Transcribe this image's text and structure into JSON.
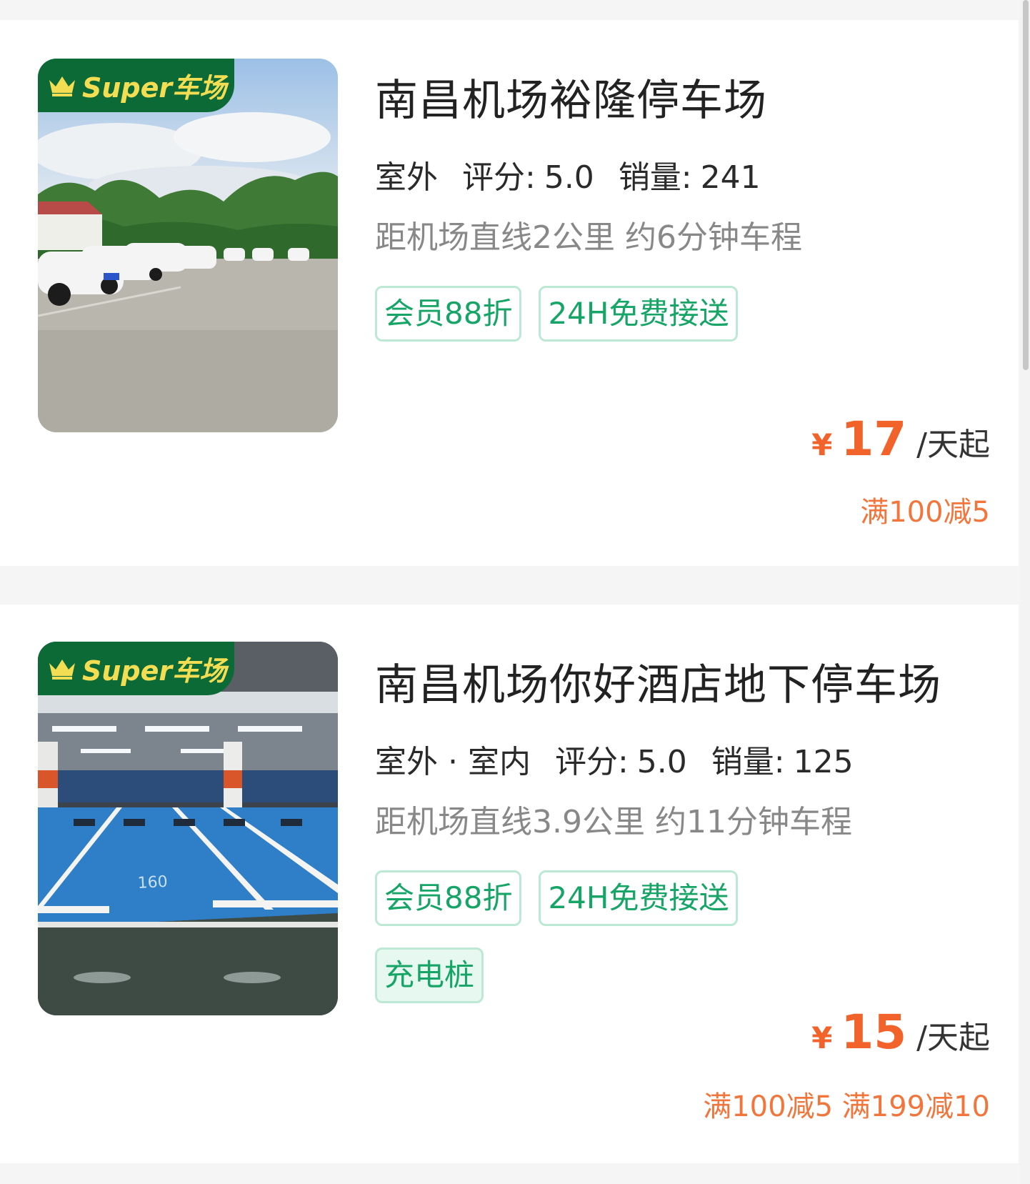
{
  "listings": [
    {
      "badge_text": "Super车场",
      "name": "南昌机场裕隆停车场",
      "types": "室外",
      "rating_label": "评分:",
      "rating": "5.0",
      "sales_label": "销量:",
      "sales": "241",
      "distance": "距机场直线2公里 约6分钟车程",
      "tags": [
        "会员88折",
        "24H免费接送"
      ],
      "price_symbol": "¥",
      "price": "17",
      "price_unit": "/天起",
      "promo": "满100减5",
      "image": "outdoor-parking-lot-photo"
    },
    {
      "badge_text": "Super车场",
      "name": "南昌机场你好酒店地下停车场",
      "types": "室外 · 室内",
      "rating_label": "评分:",
      "rating": "5.0",
      "sales_label": "销量:",
      "sales": "125",
      "distance": "距机场直线3.9公里 约11分钟车程",
      "tags": [
        "会员88折",
        "24H免费接送",
        "充电桩"
      ],
      "price_symbol": "¥",
      "price": "15",
      "price_unit": "/天起",
      "promo": "满100减5 满199减10",
      "image": "underground-parking-garage-photo"
    }
  ],
  "colors": {
    "accent_green": "#16a567",
    "price_orange": "#f2632b",
    "badge_green": "#0c6a36",
    "badge_gold": "#f3dd53"
  }
}
